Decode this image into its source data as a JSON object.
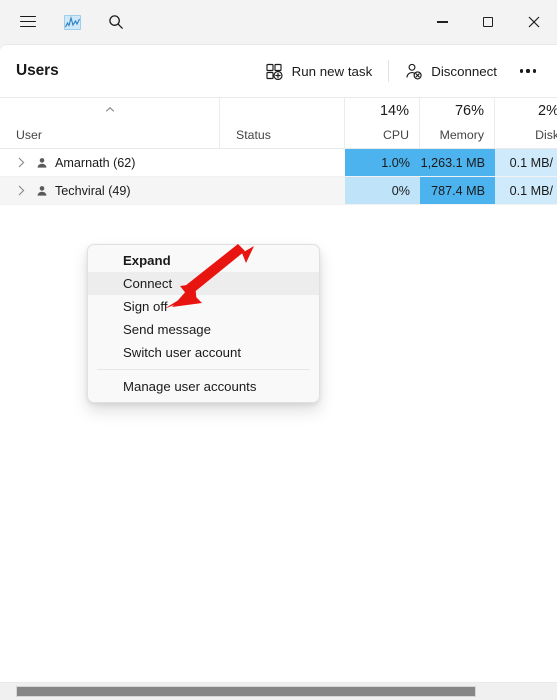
{
  "window": {
    "titlebar_icons": {
      "menu": "hamburger-menu-icon",
      "app": "task-manager-icon",
      "search": "search-icon"
    },
    "controls": {
      "minimize": "minimize-icon",
      "maximize": "maximize-icon",
      "close": "close-icon"
    }
  },
  "toolbar": {
    "title": "Users",
    "run_new_task": "Run new task",
    "disconnect": "Disconnect",
    "more_label": "See more"
  },
  "table": {
    "columns": [
      {
        "key": "user",
        "label": "User",
        "pct": "",
        "align": "left",
        "sorted": true
      },
      {
        "key": "status",
        "label": "Status",
        "pct": "",
        "align": "left",
        "sorted": false
      },
      {
        "key": "cpu",
        "label": "CPU",
        "pct": "14%",
        "align": "right",
        "sorted": false
      },
      {
        "key": "memory",
        "label": "Memory",
        "pct": "76%",
        "align": "right",
        "sorted": false
      },
      {
        "key": "disk",
        "label": "Disk",
        "pct": "2%",
        "align": "right",
        "sorted": false
      }
    ],
    "rows": [
      {
        "user": "Amarnath (62)",
        "status": "",
        "cpu": "1.0%",
        "memory": "1,263.1 MB",
        "disk": "0.1 MB/",
        "selected": false,
        "cpu_color": "#4cb3ee",
        "memory_color": "#4cb3ee",
        "disk_color": "#cfeafb"
      },
      {
        "user": "Techviral (49)",
        "status": "",
        "cpu": "0%",
        "memory": "787.4 MB",
        "disk": "0.1 MB/",
        "selected": true,
        "cpu_color": "#bfe4fa",
        "memory_color": "#4cb3ee",
        "disk_color": "#cfeafb"
      }
    ]
  },
  "context_menu": {
    "items": [
      {
        "label": "Expand",
        "bold": true,
        "highlighted": false,
        "separator_before": false
      },
      {
        "label": "Connect",
        "bold": false,
        "highlighted": true,
        "separator_before": false
      },
      {
        "label": "Sign off",
        "bold": false,
        "highlighted": false,
        "separator_before": false
      },
      {
        "label": "Send message",
        "bold": false,
        "highlighted": false,
        "separator_before": false
      },
      {
        "label": "Switch user account",
        "bold": false,
        "highlighted": false,
        "separator_before": false
      },
      {
        "label": "Manage user accounts",
        "bold": false,
        "highlighted": false,
        "separator_before": true
      }
    ]
  },
  "annotation": {
    "arrow_color": "#e81410",
    "points_to": "Sign off"
  },
  "colors": {
    "accent": "#4cb3ee",
    "titlebar_bg": "#f3f3f3",
    "panel_bg": "#ffffff",
    "menu_bg": "#f9f9f9"
  },
  "scrollbar": {
    "orientation": "horizontal",
    "thumb_color": "#868686"
  }
}
